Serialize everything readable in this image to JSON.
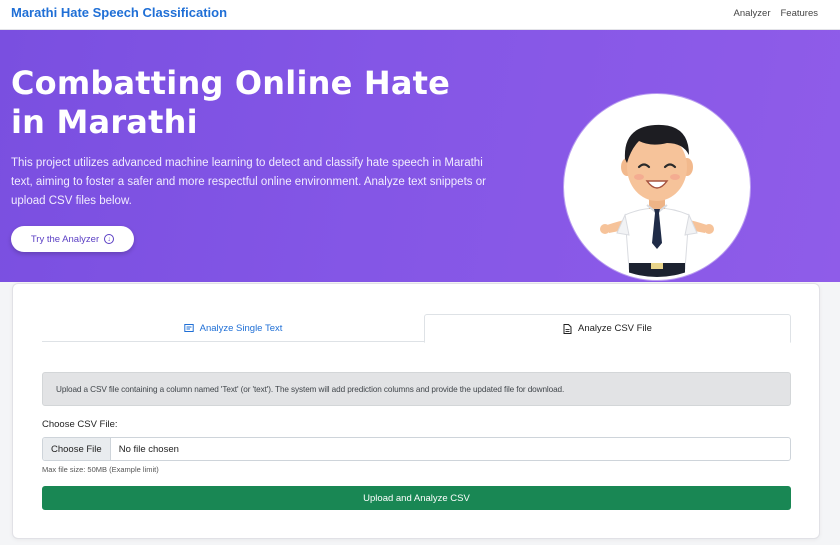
{
  "nav": {
    "brand": "Marathi Hate Speech Classification",
    "links": [
      "Analyzer",
      "Features"
    ]
  },
  "hero": {
    "title": "Combatting Online Hate in Marathi",
    "description": "This project utilizes advanced machine learning to detect and classify hate speech in Marathi text, aiming to foster a safer and more respectful online environment. Analyze text snippets or upload CSV files below.",
    "cta_label": "Try the Analyzer",
    "cta_icon": "arrow-down-circle-icon"
  },
  "tabs": [
    {
      "label": "Analyze Single Text",
      "icon": "text-icon",
      "active": false
    },
    {
      "label": "Analyze CSV File",
      "icon": "file-icon",
      "active": true
    }
  ],
  "csv": {
    "info": "Upload a CSV file containing a column named 'Text' (or 'text'). The system will add prediction columns and provide the updated file for download.",
    "label": "Choose CSV File:",
    "choose_button": "Choose File",
    "no_file": "No file chosen",
    "help": "Max file size: 50MB (Example limit)",
    "submit": "Upload and Analyze CSV"
  },
  "colors": {
    "brand": "#1f6fd6",
    "hero_gradient_start": "#7a4fe0",
    "hero_gradient_end": "#8f5ce9",
    "submit": "#198754"
  }
}
